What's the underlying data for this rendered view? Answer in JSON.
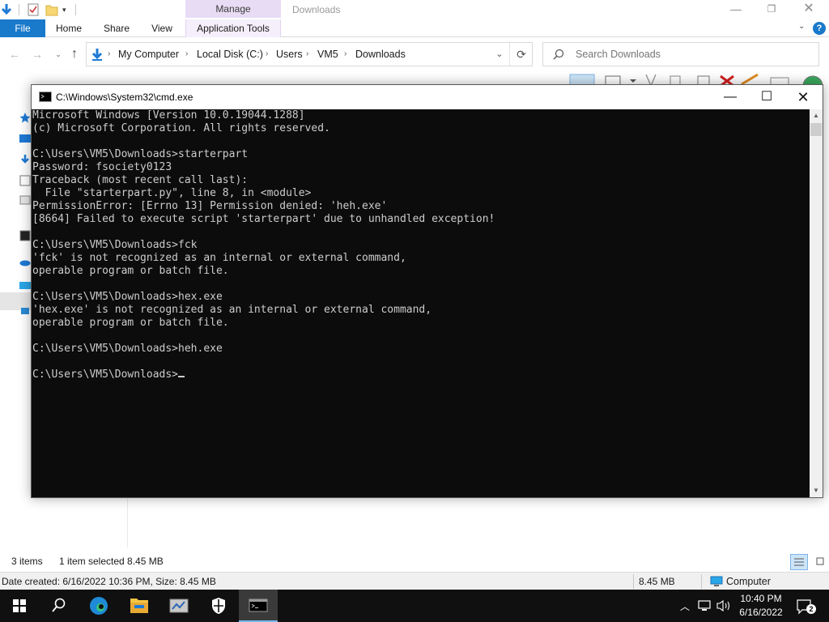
{
  "explorer": {
    "title": "Downloads",
    "context_tab_header": "Manage",
    "ribbon_tabs": {
      "file": "File",
      "home": "Home",
      "share": "Share",
      "view": "View",
      "app_tools": "Application Tools"
    },
    "help_label": "?",
    "breadcrumb": [
      "My Computer",
      "Local Disk (C:)",
      "Users",
      "VM5",
      "Downloads"
    ],
    "search_placeholder": "Search Downloads",
    "status": {
      "items": "3 items",
      "selected": "1 item selected  8.45 MB"
    },
    "details_bar": {
      "created": "Date created: 6/16/2022 10:36 PM, Size: 8.45 MB",
      "size": "8.45 MB",
      "location": "Computer"
    }
  },
  "cmd": {
    "title": "C:\\Windows\\System32\\cmd.exe",
    "lines": [
      "Microsoft Windows [Version 10.0.19044.1288]",
      "(c) Microsoft Corporation. All rights reserved.",
      "",
      "C:\\Users\\VM5\\Downloads>starterpart",
      "Password: fsociety0123",
      "Traceback (most recent call last):",
      "  File \"starterpart.py\", line 8, in <module>",
      "PermissionError: [Errno 13] Permission denied: 'heh.exe'",
      "[8664] Failed to execute script 'starterpart' due to unhandled exception!",
      "",
      "C:\\Users\\VM5\\Downloads>fck",
      "'fck' is not recognized as an internal or external command,",
      "operable program or batch file.",
      "",
      "C:\\Users\\VM5\\Downloads>hex.exe",
      "'hex.exe' is not recognized as an internal or external command,",
      "operable program or batch file.",
      "",
      "C:\\Users\\VM5\\Downloads>heh.exe",
      ""
    ],
    "prompt": "C:\\Users\\VM5\\Downloads>"
  },
  "taskbar": {
    "time": "10:40 PM",
    "date": "6/16/2022",
    "notification_count": "2",
    "pinned": [
      "windows-start-icon",
      "search-icon",
      "edge-icon",
      "file-explorer-icon",
      "server-manager-icon",
      "windows-security-icon",
      "cmd-icon"
    ]
  },
  "colors": {
    "file_tab": "#1979ca",
    "manage_context": "#e8dcf5",
    "console_bg": "#0c0c0c",
    "console_text": "#cccccc",
    "taskbar_bg": "#101010",
    "active_indicator": "#76b9ed"
  }
}
